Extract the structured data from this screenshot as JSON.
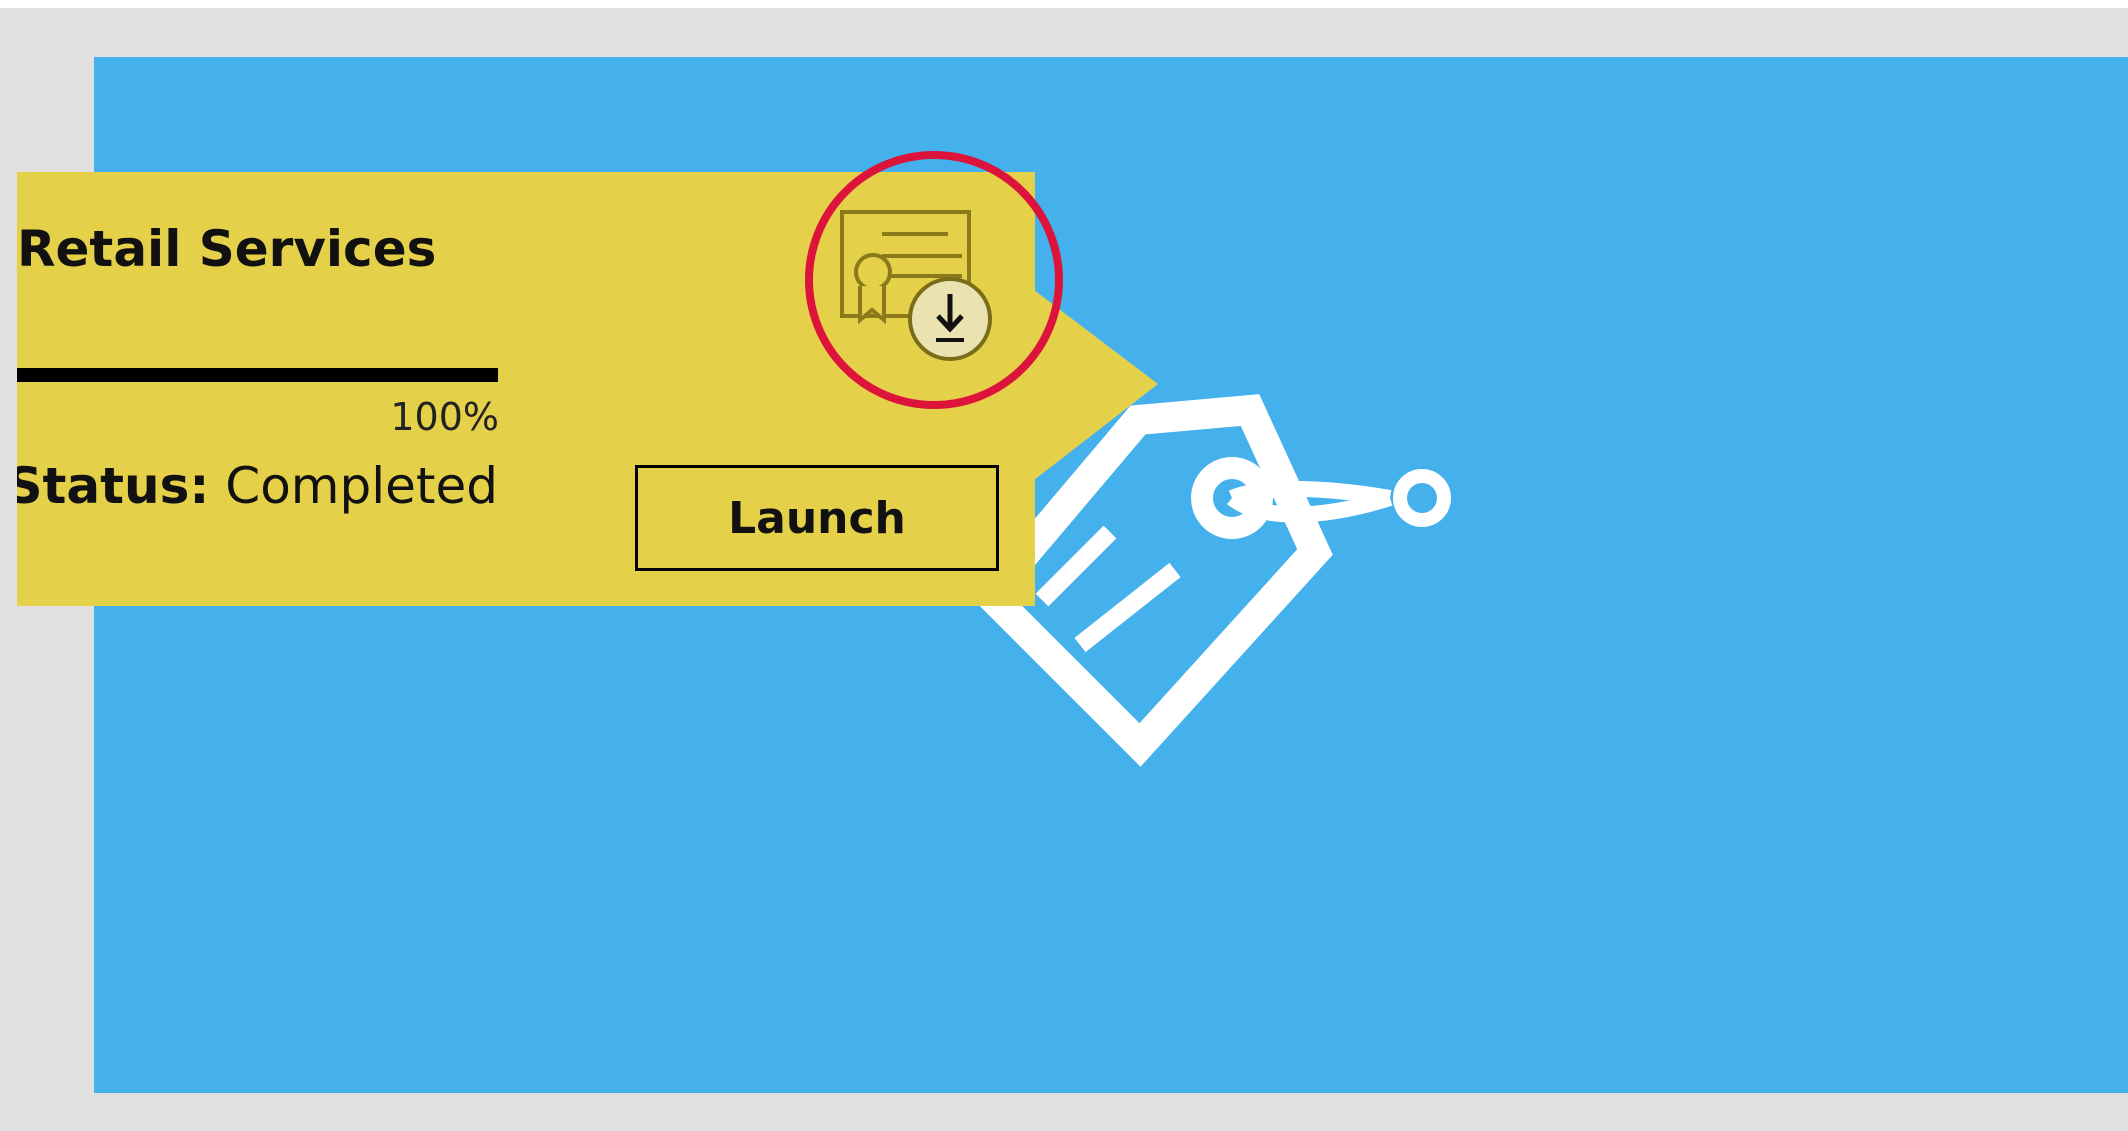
{
  "course": {
    "title": "Retail Services",
    "progress_percent": 100,
    "progress_label": "100%",
    "status_label": "Status:",
    "status_value": "Completed",
    "launch_label": "Launch"
  },
  "icons": {
    "certificate": "certificate-download-icon",
    "course_tile": "price-tag-icon"
  },
  "colors": {
    "page_background": "#e0e0e0",
    "panel_blue": "#45b1ec",
    "card_yellow": "#e5d04a",
    "highlight_red": "#dc143c",
    "icon_outline": "#8a7a1a"
  }
}
